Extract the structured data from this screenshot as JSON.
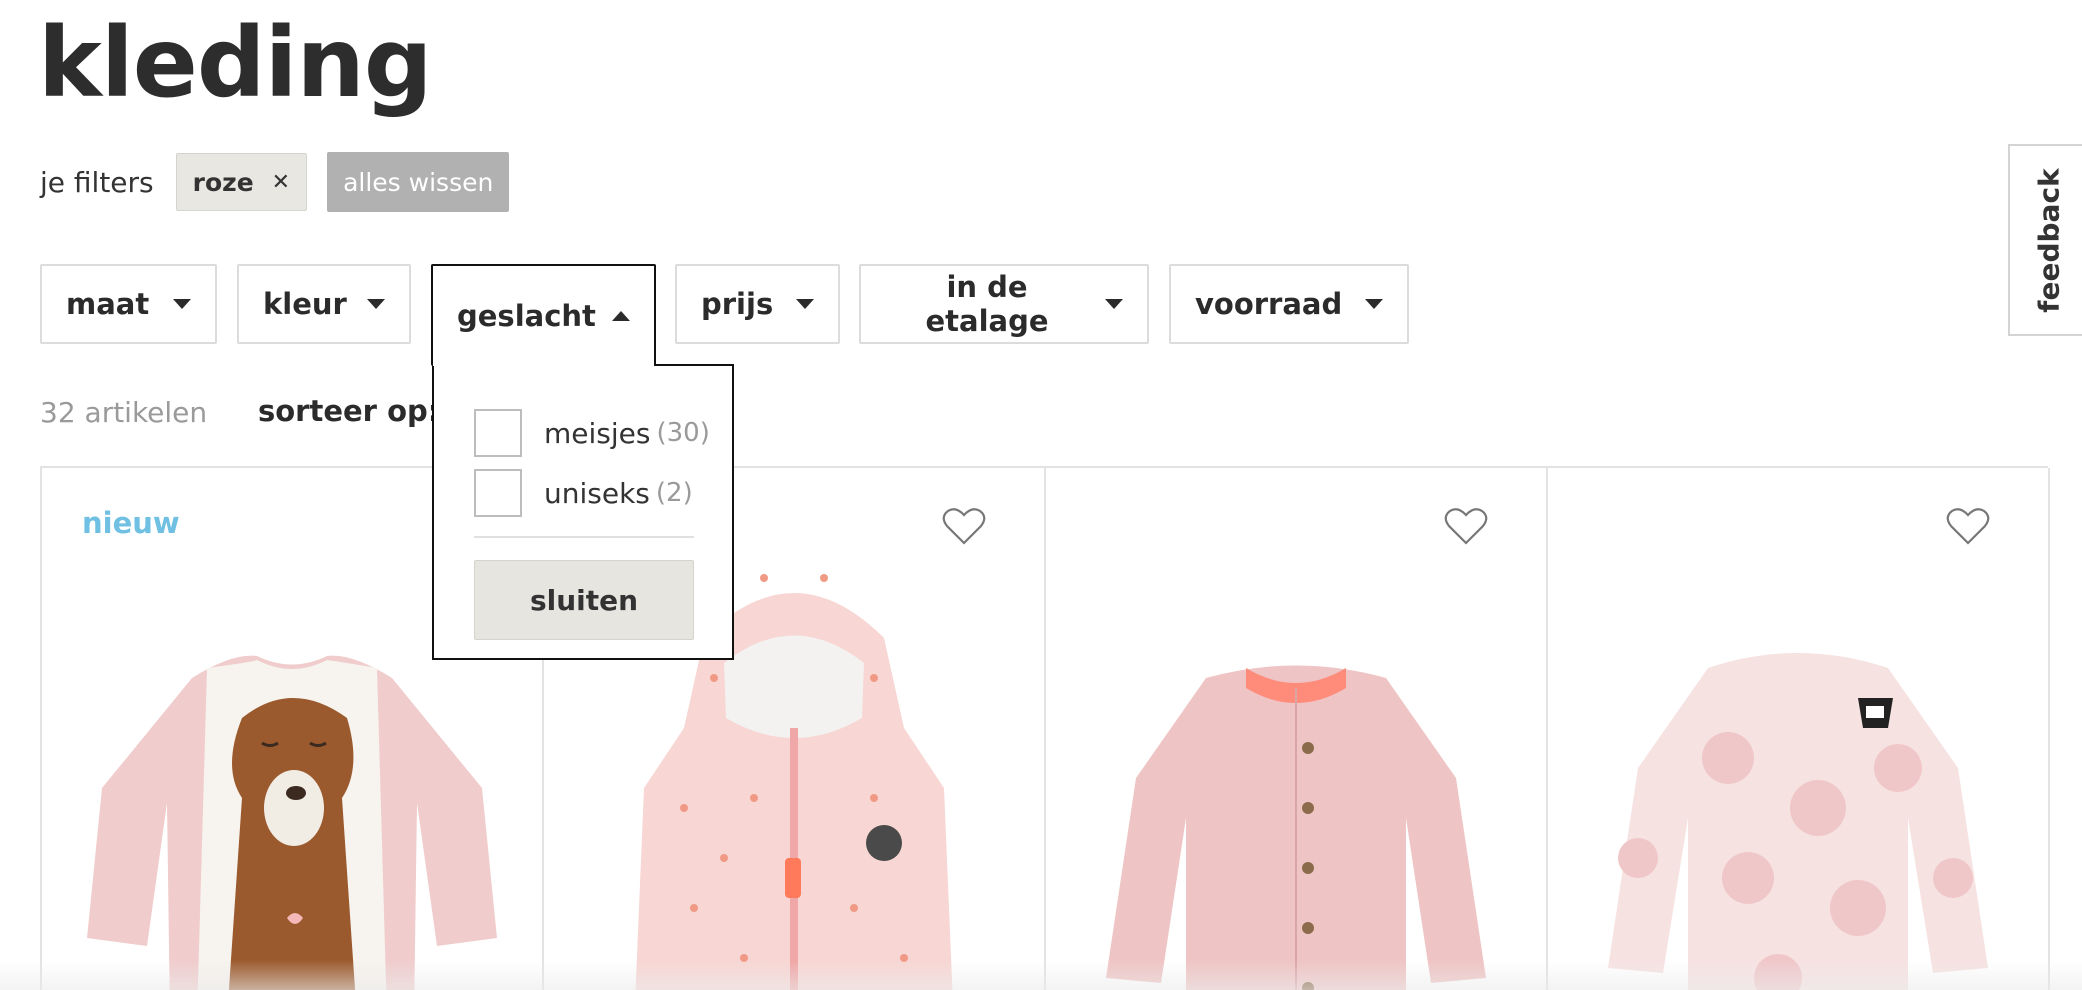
{
  "page": {
    "title": "kleding"
  },
  "active_filters": {
    "label": "je filters",
    "chips": [
      {
        "label": "roze",
        "remove_icon": "close-icon"
      }
    ],
    "clear_all": "alles wissen"
  },
  "filter_buttons": [
    {
      "label": "maat",
      "icon": "caret-down-icon"
    },
    {
      "label": "kleur",
      "icon": "caret-down-icon"
    },
    {
      "label": "geslacht",
      "icon": "caret-up-icon",
      "open": true
    },
    {
      "label": "prijs",
      "icon": "caret-down-icon"
    },
    {
      "label": "in de etalage",
      "icon": "caret-down-icon"
    },
    {
      "label": "voorraad",
      "icon": "caret-down-icon"
    }
  ],
  "gender_dropdown": {
    "options": [
      {
        "label": "meisjes",
        "count": "(30)",
        "checked": false
      },
      {
        "label": "uniseks",
        "count": "(2)",
        "checked": false
      }
    ],
    "close_label": "sluiten"
  },
  "results": {
    "count_text": "32 artikelen",
    "sort_label": "sorteer op:"
  },
  "products": [
    {
      "badge": "nieuw",
      "favorite_icon": "heart-outline-icon",
      "image": "long-sleeve-shirt-bear-print",
      "accent": "#f1c9c9"
    },
    {
      "badge": "",
      "favorite_icon": "heart-outline-icon",
      "image": "hooded-puffer-bodywarmer-stars",
      "accent": "#f6d4d1"
    },
    {
      "badge": "",
      "favorite_icon": "heart-outline-icon",
      "image": "knitted-cardigan-pink",
      "accent": "#efc2c2"
    },
    {
      "badge": "",
      "favorite_icon": "heart-outline-icon",
      "image": "long-sleeve-shirt-dots-badger",
      "accent": "#f5dcdc"
    }
  ],
  "feedback": {
    "label": "feedback"
  },
  "colors": {
    "new_badge": "#6fc0e2",
    "chip_bg": "#e9e7e2",
    "clear_bg": "#b1b1b1",
    "title": "#2d2d2d"
  }
}
